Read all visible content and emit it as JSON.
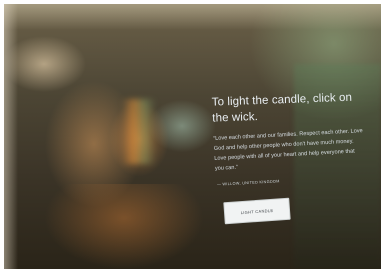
{
  "screen": {
    "heading": "To light the candle, click on the wick.",
    "quote": "“Love each other and our families. Respect each other. Love God and help other people who don't have much money. Love people with all of your heart and help everyone that you can.”",
    "attribution": "— WILLOW, UNITED KINGDOM",
    "button_label": "LIGHT CANDLE"
  },
  "colors": {
    "text": "#e9eef2",
    "button_bg": "#f1f3f3",
    "button_text": "#3a3f44"
  }
}
